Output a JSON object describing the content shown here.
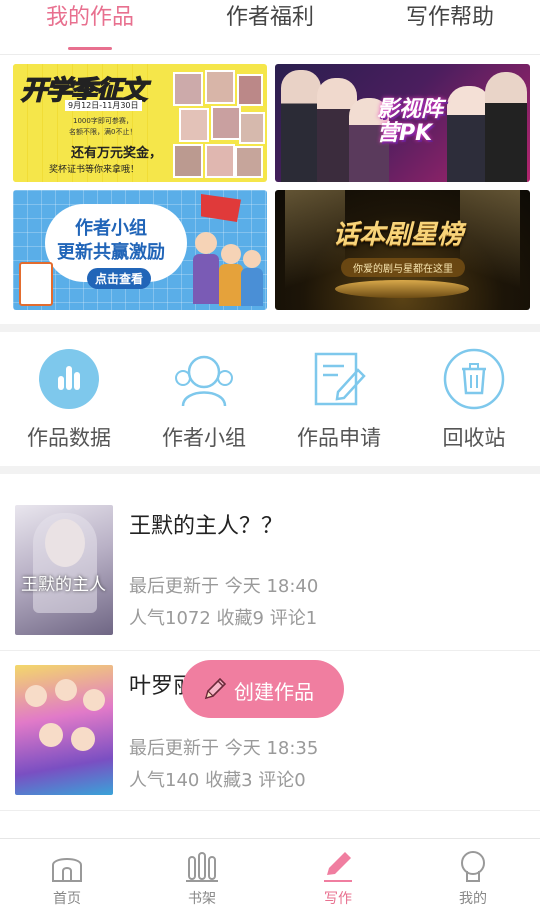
{
  "tabs": [
    {
      "label": "我的作品"
    },
    {
      "label": "作者福利"
    },
    {
      "label": "写作帮助"
    }
  ],
  "banners": [
    {
      "title": "开学季征文",
      "date": "9月12日-11月30日",
      "lines": [
        "1000字即可参赛，",
        "名额不限，满0不止！",
        "还有万元奖金，",
        "奖杯证书等你来拿哦！"
      ]
    },
    {
      "title": "影视阵营PK"
    },
    {
      "title": "作者小组",
      "subtitle": "更新共赢激励",
      "cta": "点击查看"
    },
    {
      "title": "话本剧星榜",
      "subtitle": "你爱的剧与星都在这里"
    }
  ],
  "shortcuts": [
    {
      "label": "作品数据",
      "icon": "bar-chart-icon"
    },
    {
      "label": "作者小组",
      "icon": "group-icon"
    },
    {
      "label": "作品申请",
      "icon": "edit-document-icon"
    },
    {
      "label": "回收站",
      "icon": "trash-icon"
    }
  ],
  "works": [
    {
      "title": "王默的主人？？",
      "updated": "最后更新于 今天 18:40",
      "stats": "人气1072 收藏9 评论1",
      "cover_text": "王默的主人"
    },
    {
      "title": "叶罗丽",
      "updated": "最后更新于 今天 18:35",
      "stats": "人气140 收藏3 评论0"
    }
  ],
  "fab": {
    "label": "创建作品",
    "icon": "pencil-icon"
  },
  "bottom_nav": [
    {
      "label": "首页",
      "icon": "home-icon"
    },
    {
      "label": "书架",
      "icon": "bookshelf-icon"
    },
    {
      "label": "写作",
      "icon": "write-icon"
    },
    {
      "label": "我的",
      "icon": "profile-icon"
    }
  ],
  "colors": {
    "accent": "#e8708f",
    "shortcut_blue": "#7ec8ec",
    "fab": "#f07ea0"
  }
}
